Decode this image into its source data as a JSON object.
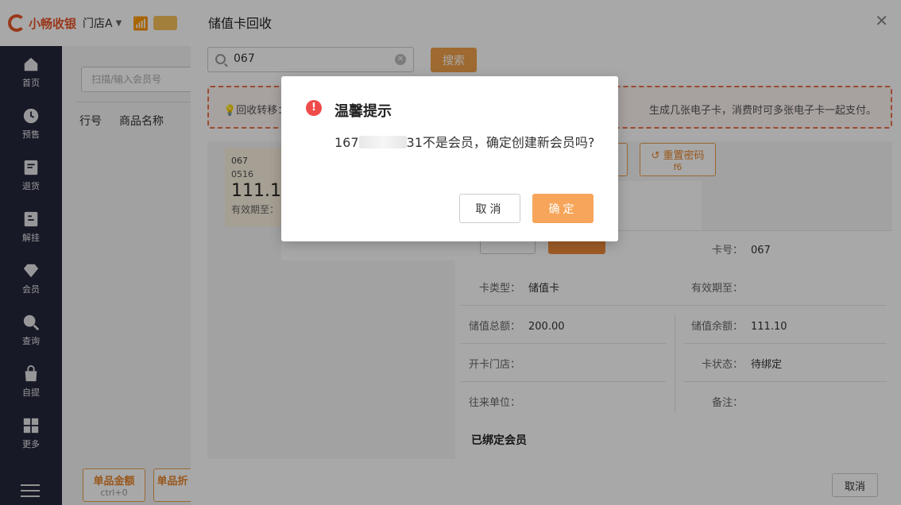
{
  "topbar": {
    "logo_text": "小畅收银",
    "store": "门店A"
  },
  "sidebar": {
    "items": [
      {
        "label": "首页",
        "icon": "home-icon"
      },
      {
        "label": "预售",
        "icon": "clock-icon"
      },
      {
        "label": "退货",
        "icon": "return-icon"
      },
      {
        "label": "解挂",
        "icon": "unhang-icon"
      },
      {
        "label": "会员",
        "icon": "diamond-icon"
      },
      {
        "label": "查询",
        "icon": "search-icon"
      },
      {
        "label": "自提",
        "icon": "bag-icon"
      },
      {
        "label": "更多",
        "icon": "grid-icon"
      }
    ]
  },
  "main": {
    "member_input_placeholder": "扫描/输入会员号",
    "table_headers": [
      "行号",
      "商品名称"
    ],
    "footer_buttons": [
      {
        "label": "单品金额",
        "shortcut": "ctrl+0"
      },
      {
        "label": "单品折",
        "shortcut": ""
      }
    ]
  },
  "drawer": {
    "title": "储值卡回收",
    "search_value": "067",
    "search_button": "搜索",
    "notice_left": "回收转移：",
    "notice_right": "生成几张电子卡，消费时可多张电子卡一起支付。",
    "card": {
      "number": "067",
      "sub": "0516",
      "amount": "111.10",
      "expire_label": "有效期至："
    },
    "reset_password": {
      "label": "重置密码",
      "shortcut": "f6"
    },
    "details": {
      "card_no_label": "卡号：",
      "card_no": "067",
      "card_type_label": "卡类型：",
      "card_type": "储值卡",
      "expire_label": "有效期至：",
      "expire": "",
      "total_label": "储值总额：",
      "total": "200.00",
      "balance_label": "储值余额：",
      "balance": "111.10",
      "open_store_label": "开卡门店：",
      "open_store": "",
      "status_label": "卡状态：",
      "status": "待绑定",
      "partner_label": "往来单位：",
      "partner": "",
      "remark_label": "备注：",
      "remark": ""
    },
    "bound_member_title": "已绑定会员",
    "cancel_button": "取消"
  },
  "modal": {
    "title": "温馨提示",
    "message_prefix": "167",
    "message_suffix": "31不是会员，确定创建新会员吗?",
    "cancel_label": "取消",
    "ok_label": "确定"
  }
}
